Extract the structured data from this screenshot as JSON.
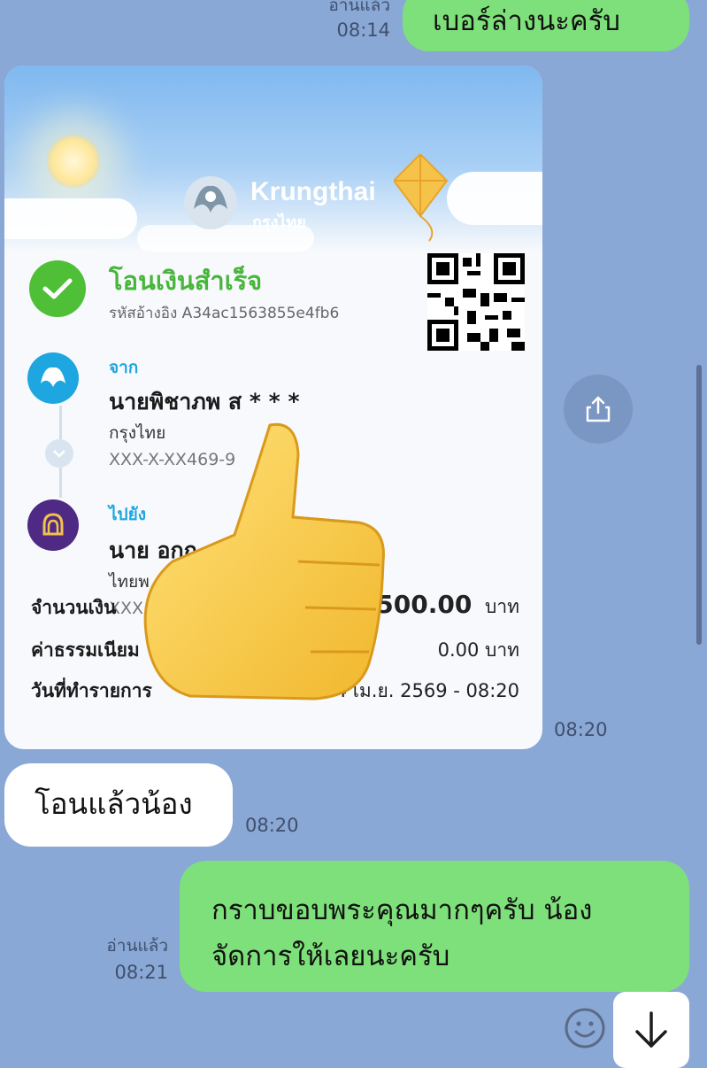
{
  "messages": {
    "top_out": {
      "text": "เบอร์ล่างนะครับ",
      "read_label": "อ่านแล้ว",
      "time": "08:14"
    },
    "slip_time": "08:20",
    "in_msg": {
      "text": "โอนแล้วน้อง",
      "time": "08:20"
    },
    "bottom_out": {
      "line1": "กราบขอบพระคุณมากๆครับ น้อง",
      "line2": "จัดการให้เลยนะครับ",
      "read_label": "อ่านแล้ว",
      "time": "08:21"
    }
  },
  "slip": {
    "brand_en": "Krungthai",
    "brand_th": "กรุงไทย",
    "status": "โอนเงินสำเร็จ",
    "reference": "รหัสอ้างอิง A34ac1563855e4fb6",
    "from": {
      "label": "จาก",
      "name": "นายพิชาภพ ส * * *",
      "bank": "กรุงไทย",
      "account": "XXX-X-XX469-9"
    },
    "to": {
      "label": "ไปยัง",
      "name": "นาย อกฤ",
      "bank": "ไทยพ",
      "account": "XXX"
    },
    "amount_label": "จำนวนเงิน",
    "amount_value": "11,500.00",
    "currency": "บาท",
    "fee_label": "ค่าธรรมเนียม",
    "fee_value": "0.00 บาท",
    "date_label": "วันที่ทำรายการ",
    "date_value": "04 เม.ย. 2569 - 08:20"
  },
  "icons": {
    "share": "share-icon",
    "emoji": "smiley-icon",
    "scroll_down": "arrow-down-icon"
  },
  "colors": {
    "background": "#8aa8d6",
    "outgoing_bubble": "#7ee07a",
    "incoming_bubble": "#ffffff",
    "success_green": "#4fbf37",
    "link_blue": "#1ea6e0"
  }
}
